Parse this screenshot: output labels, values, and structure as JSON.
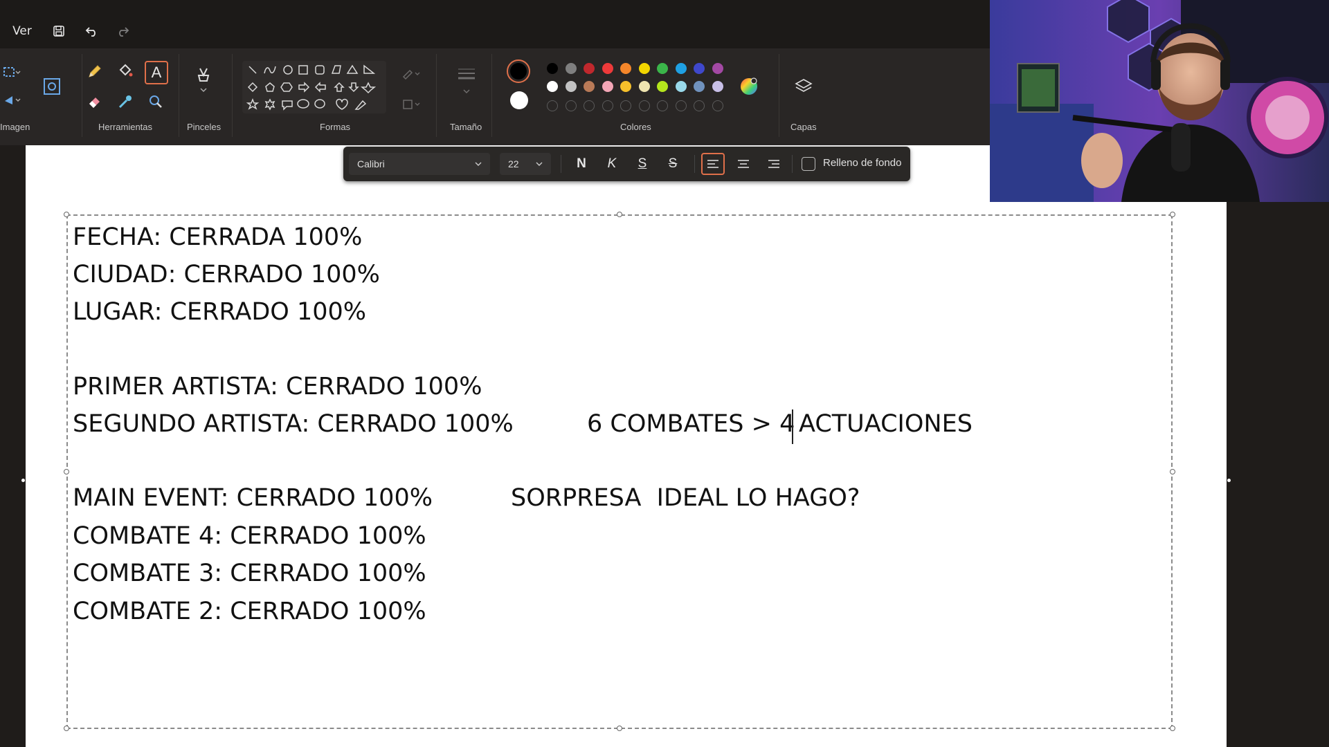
{
  "menu": {
    "view_label": "Ver"
  },
  "ribbon": {
    "groups": {
      "image": "Imagen",
      "tools": "Herramientas",
      "brushes": "Pinceles",
      "shapes": "Formas",
      "size": "Tamaño",
      "colors": "Colores",
      "layers": "Capas"
    },
    "palette_row1": [
      "#000000",
      "#7f7f7f",
      "#c0282d",
      "#ee3a3a",
      "#f4862a",
      "#f2d600",
      "#3bb54a",
      "#1fa0e3",
      "#3f48cc",
      "#a349a4"
    ],
    "palette_row2": [
      "#ffffff",
      "#c3c3c3",
      "#b97a57",
      "#f3a6b6",
      "#f6c02b",
      "#efe4b0",
      "#b5e61d",
      "#99d9ea",
      "#7092be",
      "#c8bfe7"
    ],
    "primary_color": "#000000",
    "secondary_color": "#ffffff",
    "accent_color": "#e0704a"
  },
  "format_bar": {
    "font_name": "Calibri",
    "font_size": "22",
    "bold": "N",
    "italic": "K",
    "underline": "S",
    "strikethrough": "S",
    "background_fill_label": "Relleno de fondo"
  },
  "document": {
    "lines": [
      {
        "text": "FECHA: CERRADA 100%"
      },
      {
        "text": "CIUDAD: CERRADO 100%"
      },
      {
        "text": "LUGAR: CERRADO 100%"
      },
      {
        "text": "PRIMER ARTISTA: CERRADO 100%"
      },
      {
        "text": "SEGUNDO ARTISTA: CERRADO 100%"
      },
      {
        "text": "6 COMBATES > 4"
      },
      {
        "text": "ACTUACIONES"
      },
      {
        "text": "MAIN EVENT: CERRADO 100%"
      },
      {
        "text": "SORPRESA  IDEAL LO HAGO?"
      },
      {
        "text": "COMBATE 4: CERRADO 100%"
      },
      {
        "text": "COMBATE 3: CERRADO 100%"
      },
      {
        "text": "COMBATE 2: CERRADO 100%"
      }
    ]
  }
}
